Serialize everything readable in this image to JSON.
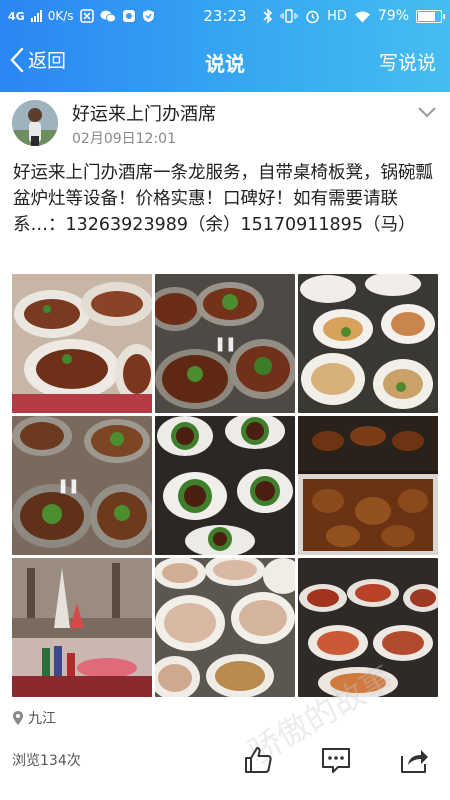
{
  "status_bar": {
    "network": "4G",
    "speed": "0K/s",
    "time": "23:23",
    "hd": "HD",
    "battery": "79%",
    "battery_level": 0.79
  },
  "nav": {
    "back_label": "返回",
    "title": "说说",
    "action_label": "写说说"
  },
  "post": {
    "author": "好运来上门办酒席",
    "time": "02月09日12:01",
    "text": "好运来上门办酒席一条龙服务，自带桌椅板凳，锅碗瓢盆炉灶等设备！价格实惠！口碑好！如有需要请联系…：13263923989（余）15170911895（马）",
    "location": "九江",
    "views": "浏览134次"
  },
  "icons": {
    "back": "chevron-left-icon",
    "more": "chevron-down-icon",
    "location": "map-pin-icon",
    "like": "thumbs-up-icon",
    "comment": "comment-icon",
    "share": "share-icon"
  },
  "colors": {
    "header_start": "#2a86f3",
    "header_end": "#46bdf0",
    "text_primary": "#222222",
    "text_secondary": "#888888"
  },
  "watermark": "骄傲的故事"
}
